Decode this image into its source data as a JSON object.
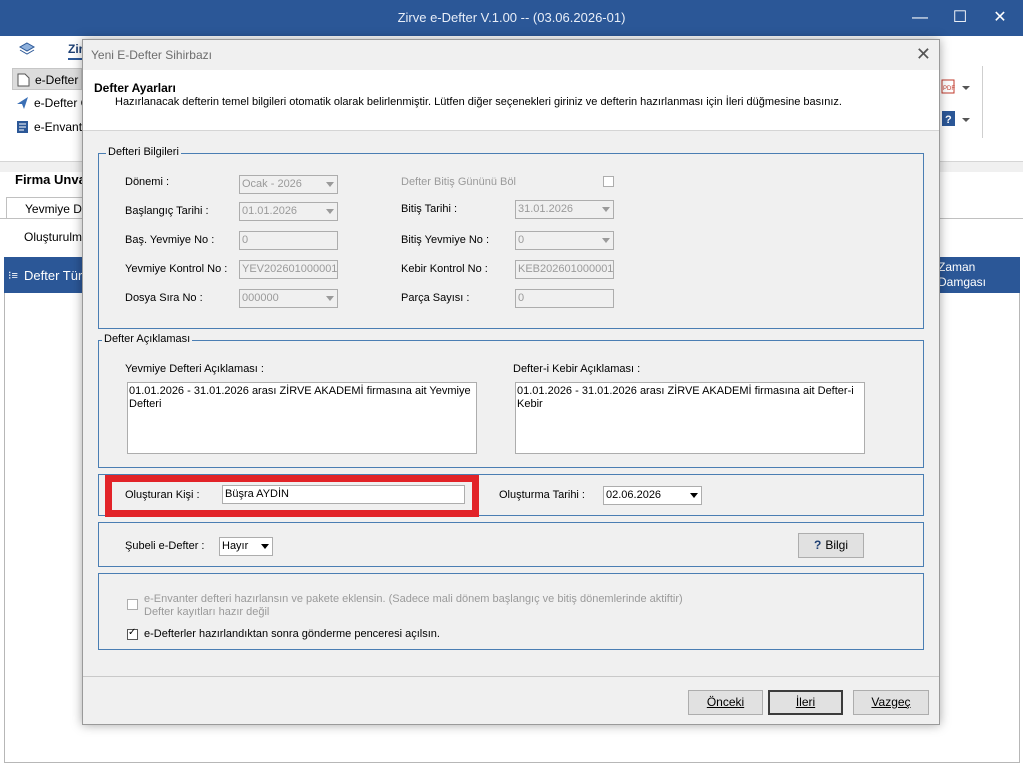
{
  "window": {
    "title": "Zirve e-Defter V.1.00  -- (03.06.2026-01)",
    "min": "—",
    "max": "☐",
    "close": "✕"
  },
  "ribbon": {
    "tab": "Zir",
    "items": [
      {
        "label": "e-Defter H",
        "icon": "document-icon"
      },
      {
        "label": "e-Defter G",
        "icon": "send-icon"
      },
      {
        "label": "e-Envanter",
        "icon": "list-icon"
      }
    ]
  },
  "background": {
    "firma": "Firma Unva",
    "subtab": "Yevmiye De",
    "olusturulmus": "Oluşturulmu",
    "grid_col1": "Defter Tür",
    "grid_col2": "Zaman Damgası"
  },
  "dialog": {
    "title": "Yeni E-Defter Sihirbazı",
    "close": "✕",
    "header_title": "Defter Ayarları",
    "header_desc": "Hazırlanacak defterin temel bilgileri otomatik olarak belirlenmiştir. Lütfen diğer seçenekleri giriniz ve defterin hazırlanması için İleri düğmesine basınız.",
    "defteri_bilgileri": {
      "legend": "Defteri Bilgileri",
      "donemi_label": "Dönemi :",
      "donemi_value": "Ocak - 2026",
      "baslangic_label": "Başlangıç Tarihi :",
      "baslangic_value": "01.01.2026",
      "bas_yevmiye_label": "Baş. Yevmiye No :",
      "bas_yevmiye_value": "0",
      "yevmiye_kontrol_label": "Yevmiye Kontrol No :",
      "yevmiye_kontrol_value": "YEV202601000001",
      "dosya_sira_label": "Dosya Sıra No :",
      "dosya_sira_value": "000000",
      "bitis_gunu_label": "Defter Bitiş Gününü Böl",
      "bitis_tarihi_label": "Bitiş Tarihi :",
      "bitis_tarihi_value": "31.01.2026",
      "bitis_yevmiye_label": "Bitiş Yevmiye No :",
      "bitis_yevmiye_value": "0",
      "kebir_kontrol_label": "Kebir Kontrol No :",
      "kebir_kontrol_value": "KEB202601000001",
      "parca_label": "Parça Sayısı :",
      "parca_value": "0"
    },
    "defter_aciklamasi": {
      "legend": "Defter Açıklaması",
      "yevmiye_label": "Yevmiye Defteri Açıklaması :",
      "yevmiye_text": "01.01.2026 - 31.01.2026 arası ZİRVE AKADEMİ  firmasına ait Yevmiye Defteri",
      "kebir_label": "Defter-i Kebir Açıklaması :",
      "kebir_text": "01.01.2026 - 31.01.2026 arası ZİRVE AKADEMİ  firmasına ait Defter-i Kebir"
    },
    "olusturan": {
      "label": "Oluşturan Kişi :",
      "value": "Büşra AYDİN",
      "tarih_label": "Oluşturma Tarihi :",
      "tarih_value": "02.06.2026"
    },
    "subeli": {
      "label": "Şubeli e-Defter :",
      "value": "Hayır",
      "bilgi_icon": "?",
      "bilgi": "Bilgi"
    },
    "options": {
      "envanter_line1": "e-Envanter defteri hazırlansın ve pakete eklensin. (Sadece mali dönem başlangıç ve bitiş dönemlerinde aktiftir)",
      "envanter_line2": "Defter kayıtları hazır değil",
      "gonderme": "e-Defterler hazırlandıktan sonra gönderme penceresi açılsın."
    },
    "buttons": {
      "onceki": "Önceki",
      "ileri": "İleri",
      "vazgec": "Vazgeç"
    }
  },
  "colors": {
    "titlebar": "#2b5797",
    "group_border": "#4a7eb3",
    "highlight": "#e22328"
  }
}
